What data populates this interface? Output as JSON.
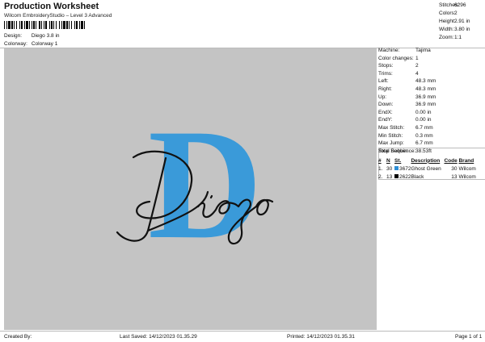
{
  "header": {
    "title": "Production Worksheet",
    "subtitle": "Wilcom EmbroideryStudio – Level 3 Advanced",
    "design_label": "Design:",
    "design_value": "Diego 3.8 in",
    "colorway_label": "Colorway:",
    "colorway_value": "Colorway 1"
  },
  "stats": [
    {
      "label": "Stitches:",
      "value": "6296"
    },
    {
      "label": "Colors:",
      "value": "2"
    },
    {
      "label": "Height:",
      "value": "2.91 in"
    },
    {
      "label": "Width:",
      "value": "3.80 in"
    },
    {
      "label": "Zoom:",
      "value": "1:1"
    }
  ],
  "details": [
    {
      "label": "Machine:",
      "value": "Tajima"
    },
    {
      "label": "Color changes:",
      "value": "1"
    },
    {
      "label": "Stops:",
      "value": "2"
    },
    {
      "label": "Trims:",
      "value": "4"
    },
    {
      "label": "Left:",
      "value": "48.3 mm"
    },
    {
      "label": "Right:",
      "value": "48.3 mm"
    },
    {
      "label": "Up:",
      "value": "36.9 mm"
    },
    {
      "label": "Down:",
      "value": "36.9 mm"
    },
    {
      "label": "EndX:",
      "value": "0.00 in"
    },
    {
      "label": "EndY:",
      "value": "0.00 in"
    },
    {
      "label": "Max Stitch:",
      "value": "6.7 mm"
    },
    {
      "label": "Min Stitch:",
      "value": "0.3 mm"
    },
    {
      "label": "Max Jump:",
      "value": "6.7 mm"
    },
    {
      "label": "Total Bobbin:",
      "value": "38.53ft"
    }
  ],
  "stop_sequence": {
    "title": "Stop Sequence:",
    "headers": [
      "#",
      "N",
      "St.",
      "Description",
      "Code",
      "Brand"
    ],
    "rows": [
      {
        "index": "1.",
        "needle": "30",
        "stitch": "3672",
        "color": "#2f8fd6",
        "description": "Ghost Green",
        "code": "30",
        "brand": "Wilcom"
      },
      {
        "index": "2.",
        "needle": "13",
        "stitch": "2622",
        "color": "#000000",
        "description": "Black",
        "code": "13",
        "brand": "Wilcom"
      }
    ]
  },
  "design": {
    "letter": "D",
    "script_text": "Diego",
    "letter_color": "#3a9ad9",
    "script_color": "#111111"
  },
  "footer": {
    "created_by": "Created By:",
    "last_saved": "Last Saved: 14/12/2023 01.35.29",
    "printed": "Printed: 14/12/2023 01.35.31",
    "page": "Page 1 of 1"
  }
}
